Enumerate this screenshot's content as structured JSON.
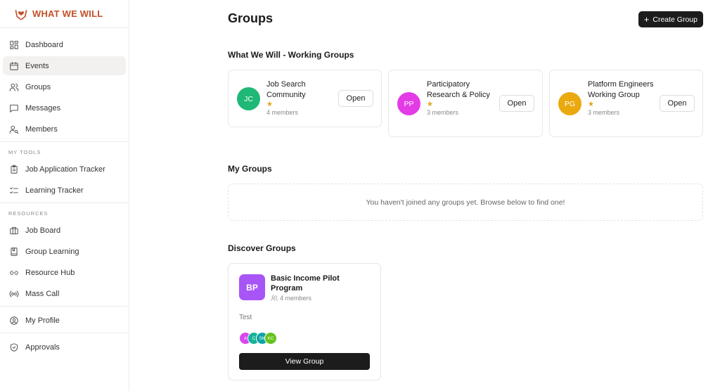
{
  "brand": {
    "name": "WHAT WE WILL",
    "icon": "hands-heart-icon",
    "color": "#c4502a"
  },
  "sidebar": {
    "main_items": [
      {
        "label": "Dashboard",
        "icon": "dashboard-icon",
        "active": false
      },
      {
        "label": "Events",
        "icon": "calendar-icon",
        "active": true
      },
      {
        "label": "Groups",
        "icon": "users-icon",
        "active": false
      },
      {
        "label": "Messages",
        "icon": "message-icon",
        "active": false
      },
      {
        "label": "Members",
        "icon": "user-search-icon",
        "active": false
      }
    ],
    "tools_label": "MY TOOLS",
    "tools_items": [
      {
        "label": "Job Application Tracker",
        "icon": "clipboard-icon"
      },
      {
        "label": "Learning Tracker",
        "icon": "list-check-icon"
      }
    ],
    "resources_label": "RESOURCES",
    "resources_items": [
      {
        "label": "Job Board",
        "icon": "briefcase-icon"
      },
      {
        "label": "Group Learning",
        "icon": "book-icon"
      },
      {
        "label": "Resource Hub",
        "icon": "link-icon"
      },
      {
        "label": "Mass Call",
        "icon": "broadcast-icon"
      }
    ],
    "profile_label": "My Profile",
    "approvals_label": "Approvals"
  },
  "header": {
    "title": "Groups",
    "create_button": "Create Group"
  },
  "working_groups": {
    "title": "What We Will - Working Groups",
    "open_label": "Open",
    "items": [
      {
        "initials": "JC",
        "name": "Job Search Community",
        "members": "4 members",
        "color": "#1fb876"
      },
      {
        "initials": "PP",
        "name": "Participatory Research & Policy",
        "members": "3 members",
        "color": "#e33be6"
      },
      {
        "initials": "PG",
        "name": "Platform Engineers Working Group",
        "members": "3 members",
        "color": "#eaa90e"
      }
    ]
  },
  "my_groups": {
    "title": "My Groups",
    "empty_text": "You haven't joined any groups yet. Browse below to find one!"
  },
  "discover": {
    "title": "Discover Groups",
    "card": {
      "initials": "BP",
      "name": "Basic Income Pilot Program",
      "members": "4 members",
      "description": "Test",
      "member_avatars": [
        {
          "initials": "A",
          "color": "#d946ef"
        },
        {
          "initials": "C",
          "color": "#16b39a"
        },
        {
          "initials": "SK",
          "color": "#0ea5a4"
        },
        {
          "initials": "KC",
          "color": "#65c31b"
        }
      ],
      "button": "View Group"
    }
  }
}
